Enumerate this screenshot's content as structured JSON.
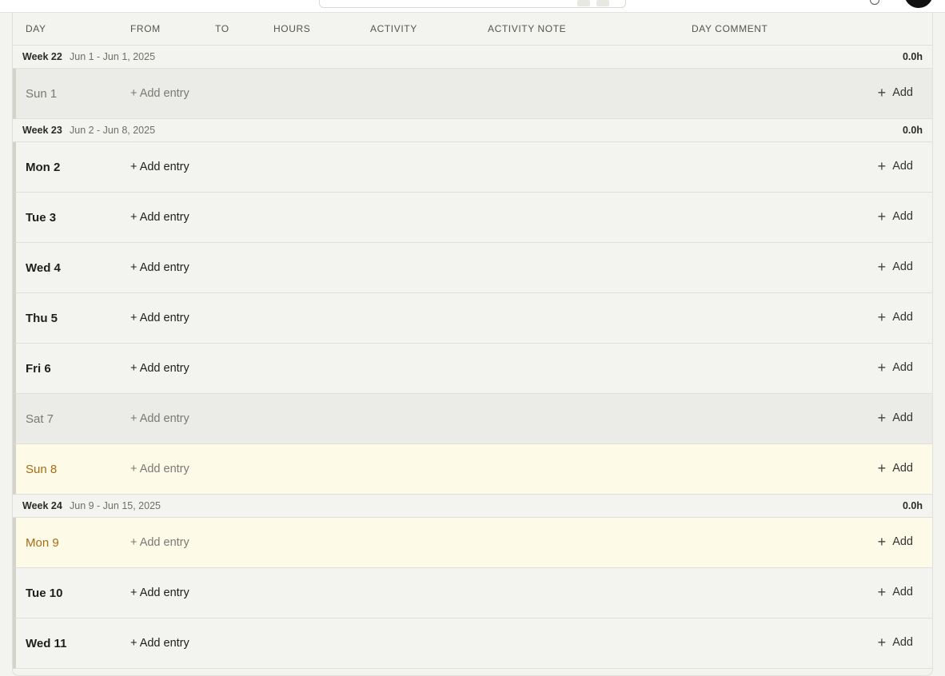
{
  "columns": [
    "DAY",
    "FROM",
    "TO",
    "HOURS",
    "ACTIVITY",
    "ACTIVITY NOTE",
    "DAY COMMENT"
  ],
  "add_entry_label": "+ Add entry",
  "add_label": "Add",
  "plus_glyph": "+",
  "weeks": [
    {
      "label": "Week 22",
      "range": "Jun 1 - Jun 1, 2025",
      "total": "0.0h",
      "days": [
        {
          "label": "Sun 1",
          "kind": "weekend"
        }
      ]
    },
    {
      "label": "Week 23",
      "range": "Jun 2 - Jun 8, 2025",
      "total": "0.0h",
      "days": [
        {
          "label": "Mon 2",
          "kind": "weekday"
        },
        {
          "label": "Tue 3",
          "kind": "weekday"
        },
        {
          "label": "Wed 4",
          "kind": "weekday"
        },
        {
          "label": "Thu 5",
          "kind": "weekday"
        },
        {
          "label": "Fri 6",
          "kind": "weekday"
        },
        {
          "label": "Sat 7",
          "kind": "weekend"
        },
        {
          "label": "Sun 8",
          "kind": "highlight"
        }
      ]
    },
    {
      "label": "Week 24",
      "range": "Jun 9 - Jun 15, 2025",
      "total": "0.0h",
      "days": [
        {
          "label": "Mon 9",
          "kind": "highlight"
        },
        {
          "label": "Tue 10",
          "kind": "weekday"
        },
        {
          "label": "Wed 11",
          "kind": "weekday"
        }
      ]
    }
  ],
  "colors": {
    "background": "#f3f3ef",
    "weekend_row": "#ebebe7",
    "highlight_row": "#fdfbe8",
    "highlight_text": "#a86a12",
    "avatar": "#111111"
  }
}
